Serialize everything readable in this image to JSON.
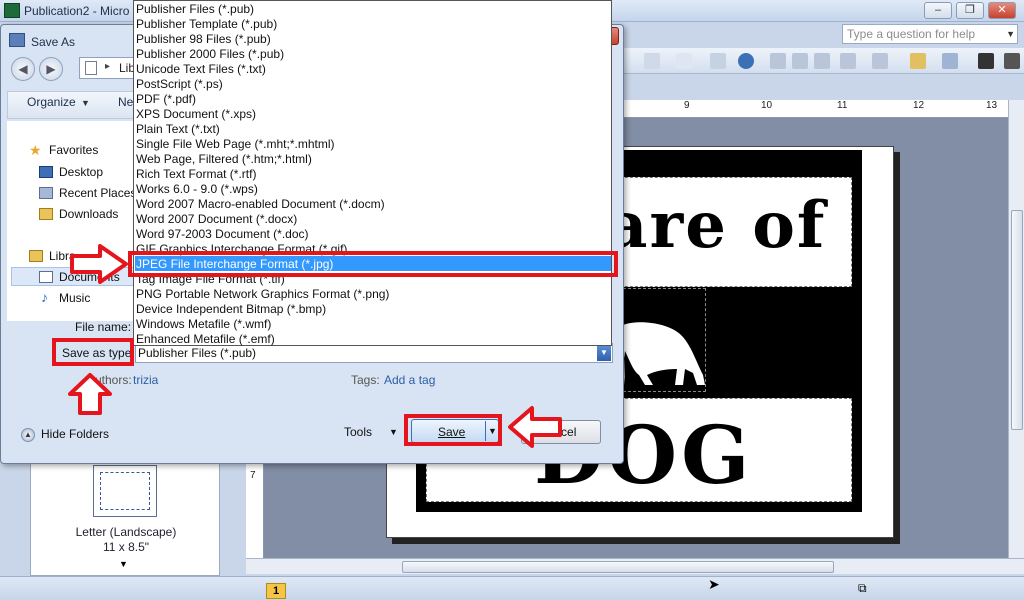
{
  "publisher": {
    "title": "Publication2 - Micro",
    "help_placeholder": "Type a question for help",
    "ruler_numbers": [
      "9",
      "10",
      "11",
      "12",
      "13"
    ],
    "ruler_vertical_number": "7",
    "page_number": "1",
    "template_name": "Letter (Landscape)",
    "template_size": "11 x 8.5\"",
    "sign_top_text": "are of",
    "sign_bottom_text": "DOG"
  },
  "dialog": {
    "title": "Save As",
    "address_fragment": "Lib",
    "organize_label": "Organize",
    "new_folder_label": "Ne",
    "nav": {
      "favorites": "Favorites",
      "desktop": "Desktop",
      "recent_places": "Recent Places",
      "downloads": "Downloads",
      "libraries": "Libra",
      "documents": "Documents",
      "music": "Music"
    },
    "file_name_label": "File name:",
    "save_as_type_label": "Save as type:",
    "selected_type": "Publisher Files (*.pub)",
    "authors_label": "Authors:",
    "authors_value": "trizia",
    "tags_label": "Tags:",
    "tags_value": "Add a tag",
    "hide_folders_label": "Hide Folders",
    "tools_label": "Tools",
    "save_label": "Save",
    "cancel_label": "Cancel"
  },
  "type_options": [
    "Publisher Files (*.pub)",
    "Publisher Template (*.pub)",
    "Publisher 98 Files (*.pub)",
    "Publisher 2000 Files (*.pub)",
    "Unicode Text Files (*.txt)",
    "PostScript (*.ps)",
    "PDF (*.pdf)",
    "XPS Document (*.xps)",
    "Plain Text (*.txt)",
    "Single File Web Page (*.mht;*.mhtml)",
    "Web Page, Filtered (*.htm;*.html)",
    "Rich Text Format (*.rtf)",
    "Works 6.0 - 9.0 (*.wps)",
    "Word 2007 Macro-enabled Document (*.docm)",
    "Word 2007 Document (*.docx)",
    "Word 97-2003 Document (*.doc)",
    "GIF Graphics Interchange Format (*.gif)",
    "JPEG File Interchange Format (*.jpg)",
    "Tag Image File Format (*.tif)",
    "PNG Portable Network Graphics Format (*.png)",
    "Device Independent Bitmap (*.bmp)",
    "Windows Metafile (*.wmf)",
    "Enhanced Metafile (*.emf)"
  ],
  "colors": {
    "annotation_red": "#e5151d",
    "selection_blue": "#3399ff"
  }
}
